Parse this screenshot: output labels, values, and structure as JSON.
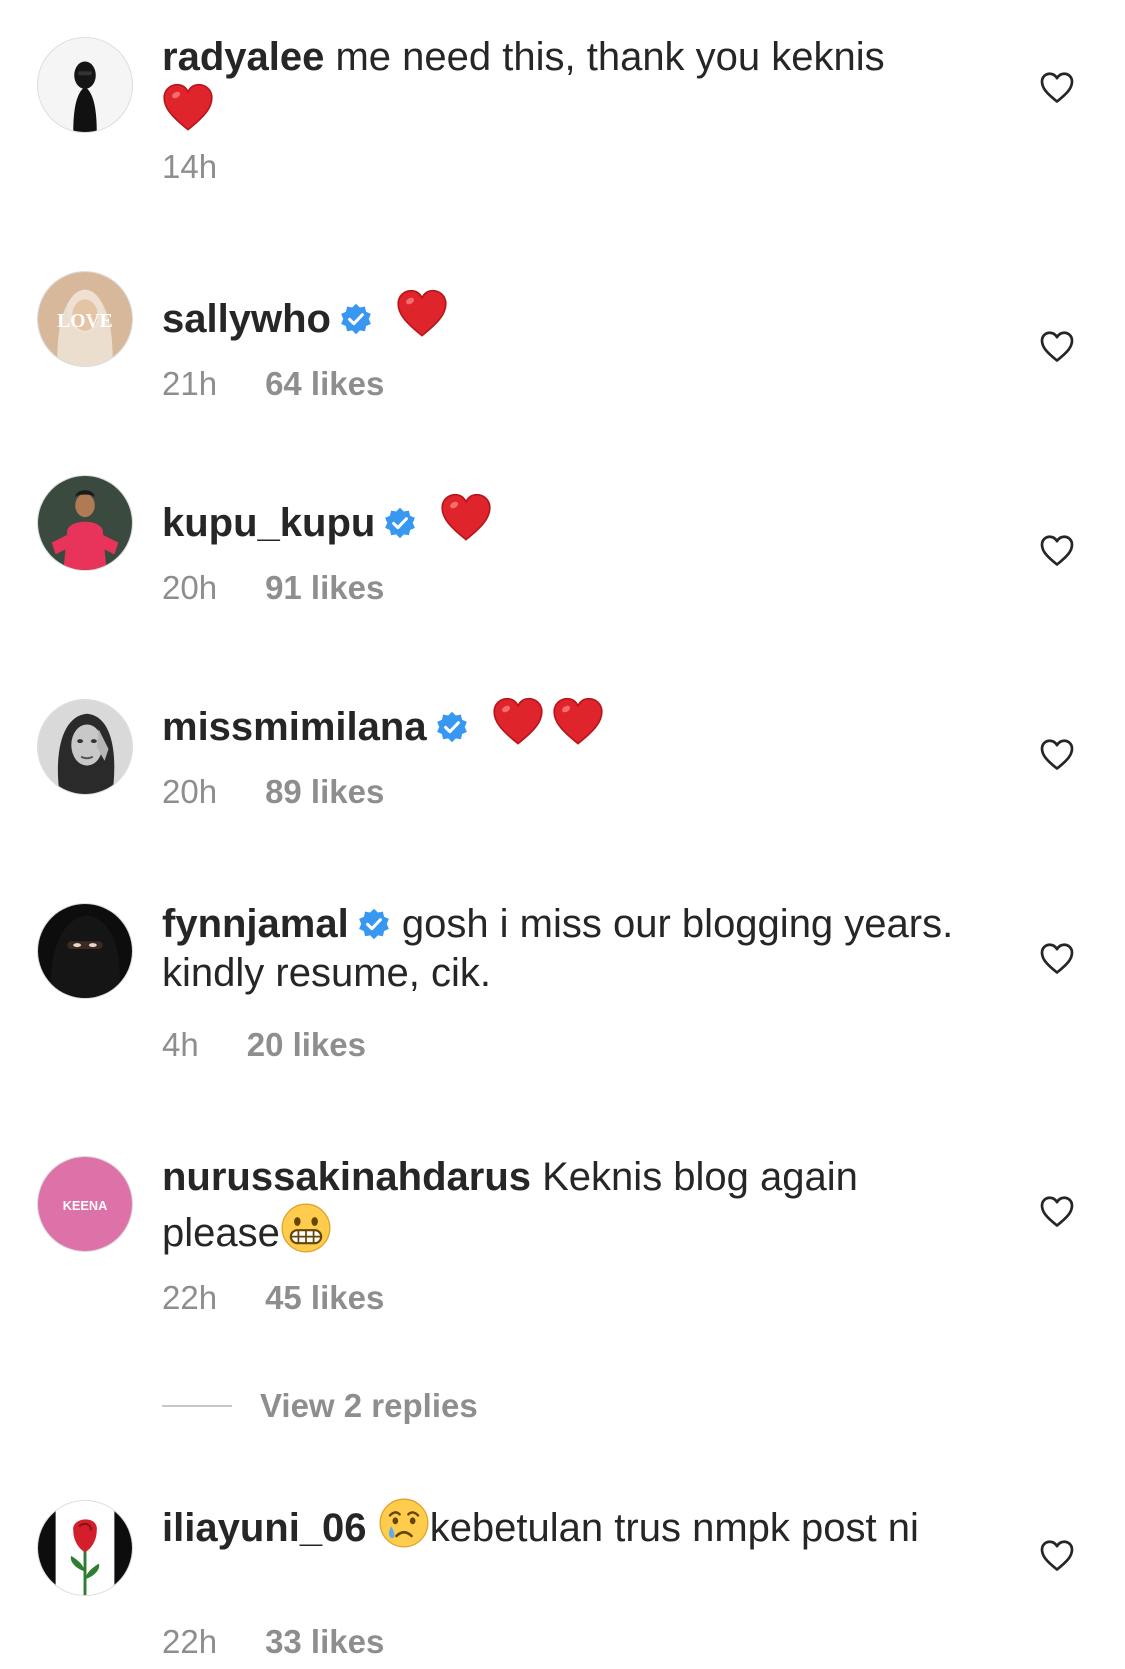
{
  "comments": [
    {
      "username": "radyalee",
      "text": " me need this, thank you keknis",
      "time": "14h",
      "likes": ""
    },
    {
      "username": "sallywho",
      "text": "",
      "time": "21h",
      "likes": "64 likes",
      "avatar_text": "LOVE"
    },
    {
      "username": "kupu_kupu",
      "text": "",
      "time": "20h",
      "likes": "91 likes"
    },
    {
      "username": "missmimilana",
      "text": "",
      "time": "20h",
      "likes": "89 likes"
    },
    {
      "username": "fynnjamal",
      "text": " gosh i miss our blogging years. kindly resume, cik.",
      "time": "4h",
      "likes": "20 likes"
    },
    {
      "username": "nurussakinahdarus",
      "text": " Keknis blog again please",
      "time": "22h",
      "likes": "45 likes",
      "avatar_text": "KEENA"
    },
    {
      "username": "iliayuni_06",
      "text_before": " ",
      "text": "kebetulan trus nmpk post ni",
      "time": "22h",
      "likes": "33 likes"
    }
  ],
  "replies_link": "View 2 replies",
  "icons": {
    "like": "heart-outline-icon",
    "verified": "verified-badge-icon",
    "emoji_heart": "red-heart-emoji",
    "emoji_grimace": "grimacing-face-emoji",
    "emoji_cry": "crying-face-emoji"
  },
  "colors": {
    "text": "#262626",
    "muted": "#8e8e8e",
    "verified": "#3897f0",
    "heart_emoji": "#e0242b"
  }
}
